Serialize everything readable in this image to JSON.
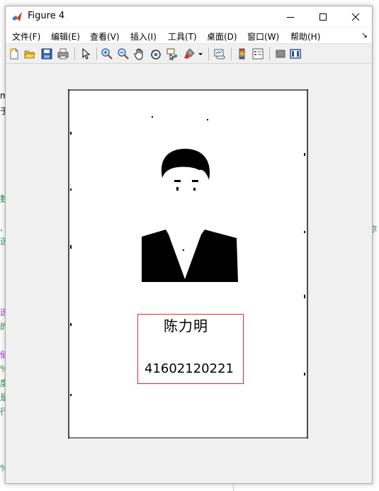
{
  "window": {
    "title": "Figure 4"
  },
  "menu": [
    "文件(F)",
    "编辑(E)",
    "查看(V)",
    "插入(I)",
    "工具(T)",
    "桌面(D)",
    "窗口(W)",
    "帮助(H)"
  ],
  "toolbar": {
    "icons": [
      "new-figure-icon",
      "open-icon",
      "save-icon",
      "print-icon",
      "pointer-icon",
      "zoom-in-icon",
      "zoom-out-icon",
      "pan-icon",
      "rotate-3d-icon",
      "data-cursor-icon",
      "brush-icon",
      "link-plot-icon",
      "colorbar-icon",
      "legend-icon",
      "hide-plot-tools-icon",
      "show-plot-tools-icon"
    ]
  },
  "figure": {
    "name_text": "陈力明",
    "number_text": "41602120221",
    "box_color": "#e0292f"
  },
  "background": {
    "left_fragments": [
      "m",
      "于",
      "数",
      ",",
      "选",
      "选",
      "的",
      "储",
      "%",
      "度",
      "是",
      "行",
      "%"
    ],
    "right_fragment": "你"
  }
}
